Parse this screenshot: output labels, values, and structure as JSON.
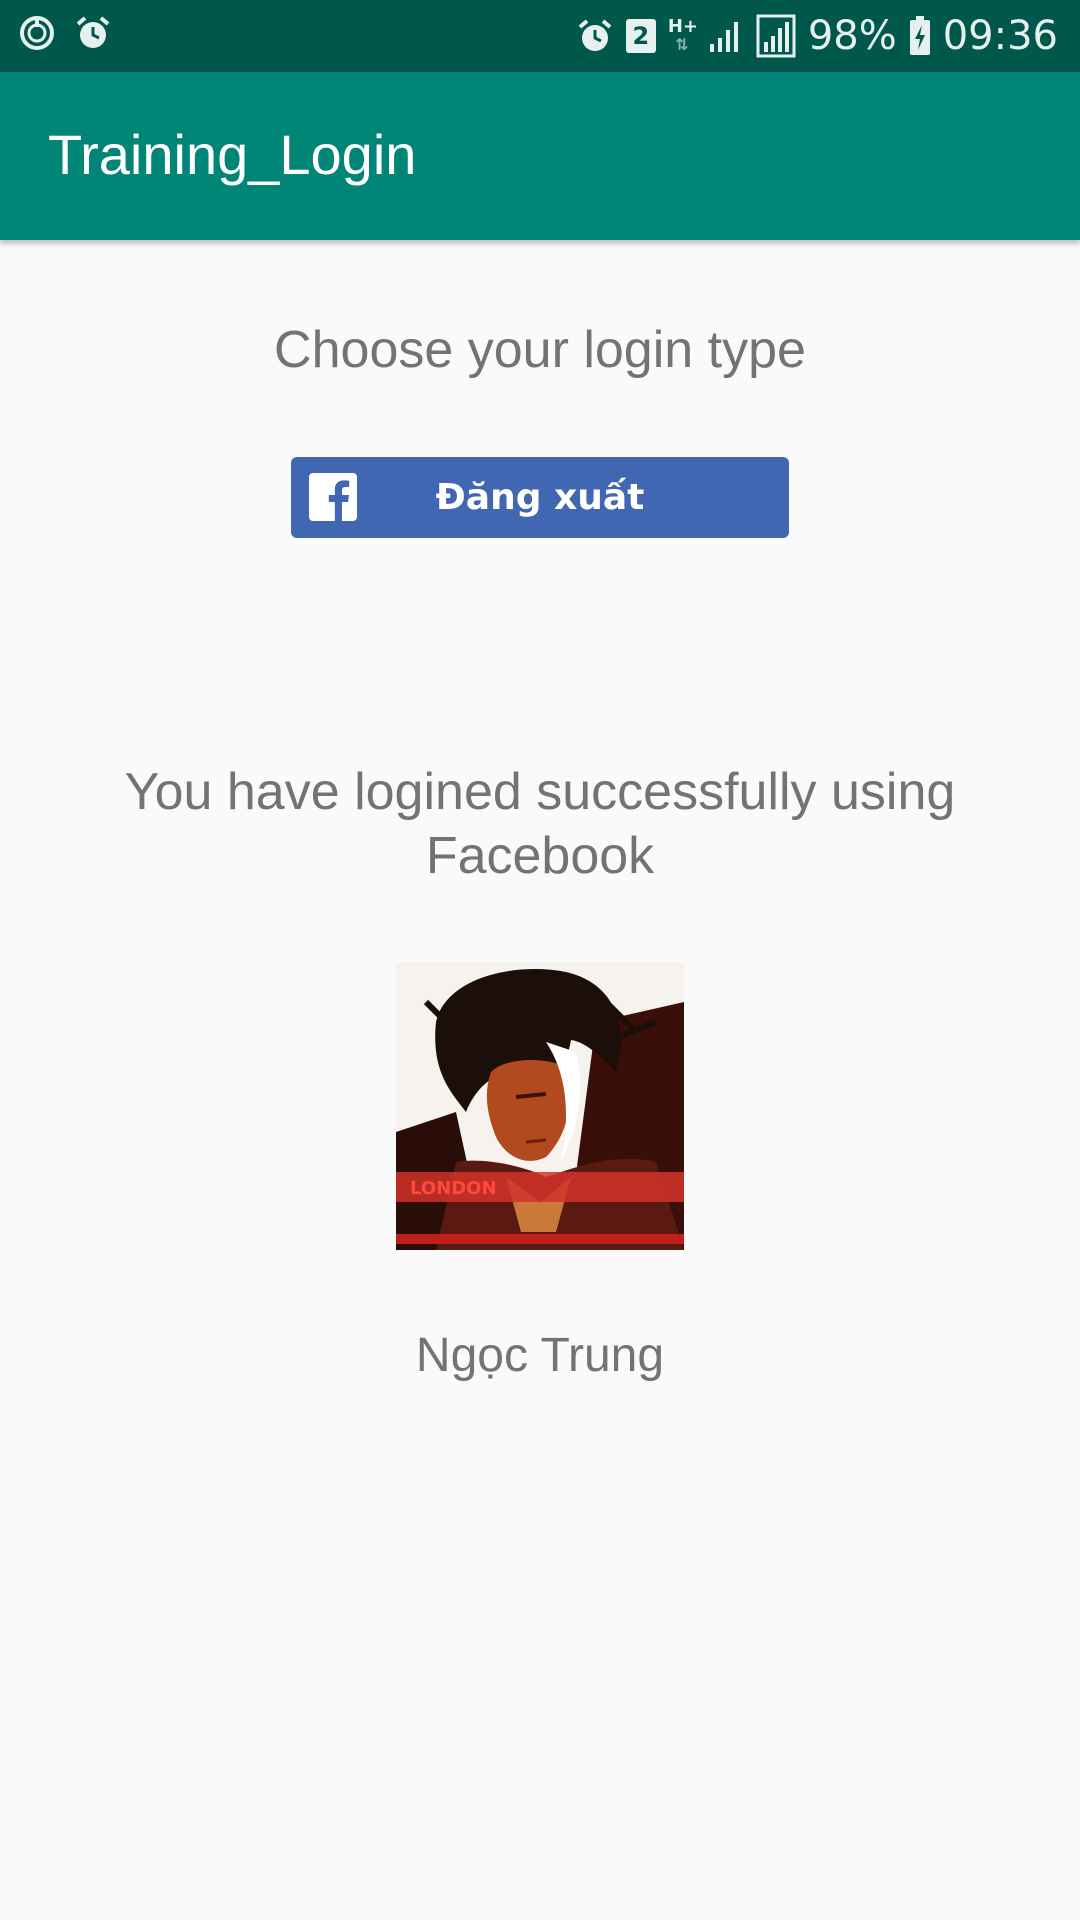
{
  "status_bar": {
    "battery": "98%",
    "time": "09:36",
    "notification_count": "2",
    "network_type": "H+",
    "left_icons": [
      "sync-icon",
      "alarm-icon"
    ],
    "right_icons": [
      "alarm-icon",
      "notification-badge",
      "hplus-icon",
      "signal-icon",
      "signal-icon",
      "battery-icon"
    ]
  },
  "app_bar": {
    "title": "Training_Login",
    "color": "#008577",
    "status_color": "#00574b"
  },
  "main": {
    "choose_label": "Choose your login type",
    "facebook_button": {
      "label": "Đăng xuất",
      "icon": "facebook-logo-icon",
      "color": "#4267b2"
    },
    "success_message": "You have logined successfully using Facebook",
    "avatar_overlay_text": "LONDON",
    "user_name": "Ngọc Trung"
  }
}
